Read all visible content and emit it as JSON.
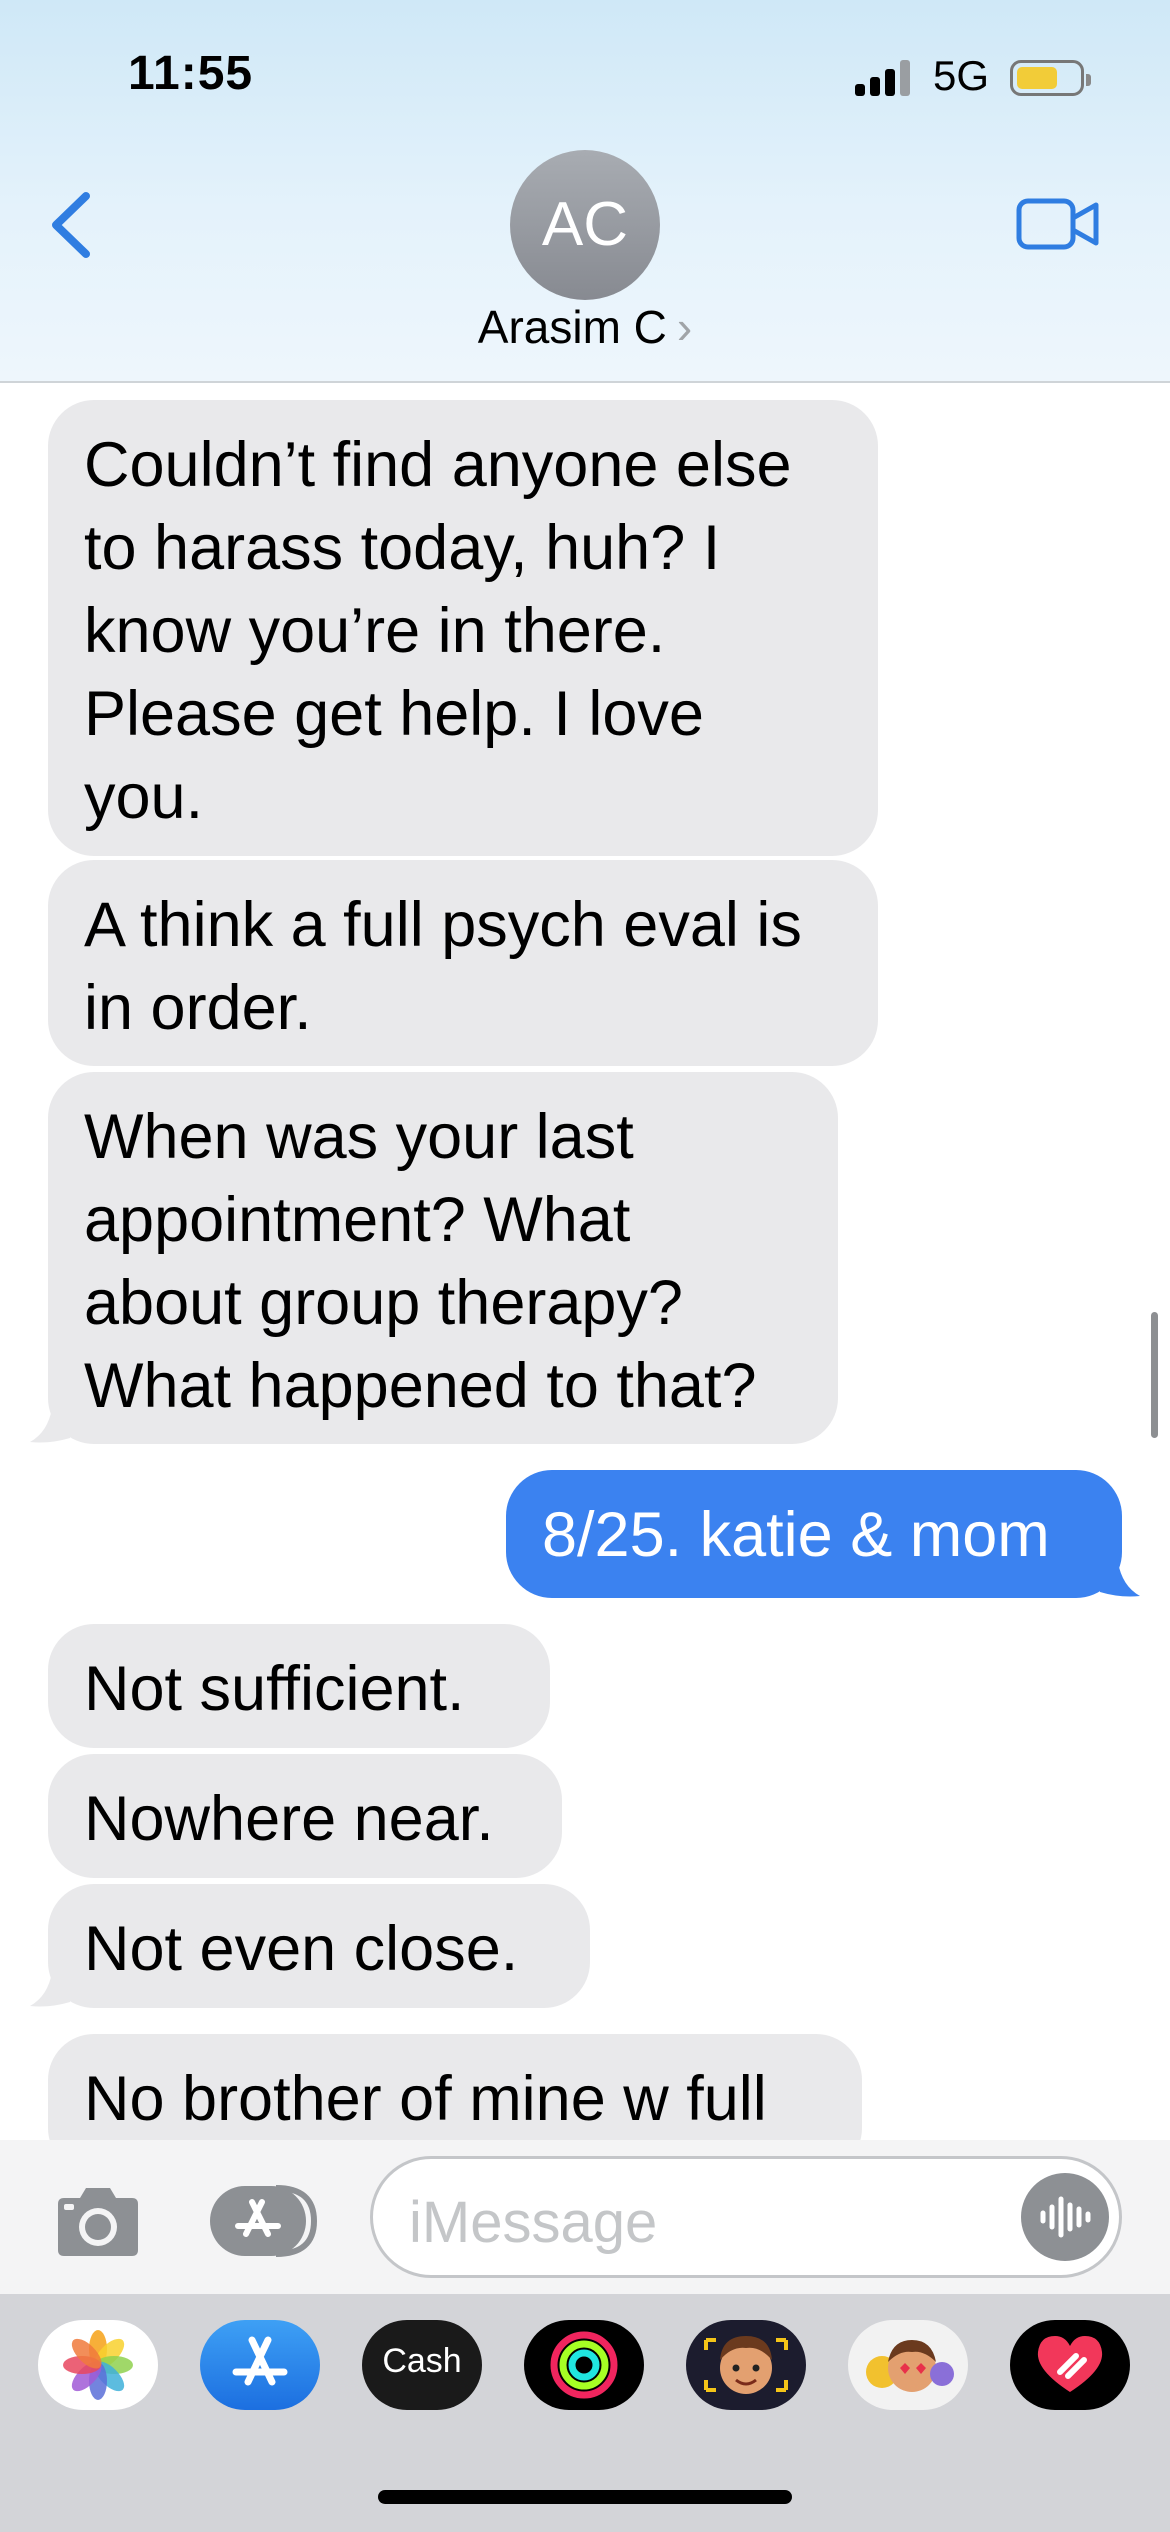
{
  "status_bar": {
    "time": "11:55",
    "network": "5G"
  },
  "header": {
    "avatar_initials": "AC",
    "contact_name": "Arasim C",
    "chevron": "›",
    "back_icon": "chevron-left-icon",
    "video_icon": "video-camera-icon"
  },
  "messages": [
    {
      "direction": "incoming",
      "text": "Couldn’t find anyone else\nto harass today, huh?  I\nknow you’re in there.\nPlease get help.  I love\nyou."
    },
    {
      "direction": "incoming",
      "text": "A think a full psych eval is\nin order."
    },
    {
      "direction": "incoming",
      "text": "When was your last\nappointment?  What\nabout group therapy?\nWhat happened to that?"
    },
    {
      "direction": "outgoing",
      "text": "8/25. katie & mom"
    },
    {
      "direction": "incoming",
      "text": "Not sufficient."
    },
    {
      "direction": "incoming",
      "text": "Nowhere near."
    },
    {
      "direction": "incoming",
      "text": "Not even close."
    },
    {
      "direction": "incoming",
      "text": "No brother of mine w full"
    }
  ],
  "input": {
    "placeholder": "iMessage"
  },
  "app_drawer": [
    {
      "name": "Photos",
      "icon": "photos-icon"
    },
    {
      "name": "App Store",
      "icon": "app-store-icon"
    },
    {
      "name": "Cash",
      "icon": "cash-app-icon",
      "label": "Cash"
    },
    {
      "name": "Activity",
      "icon": "activity-rings-icon"
    },
    {
      "name": "Memoji",
      "icon": "memoji-icon"
    },
    {
      "name": "Memoji Stickers",
      "icon": "memoji-stickers-icon"
    },
    {
      "name": "Digital Touch",
      "icon": "digital-touch-icon"
    }
  ],
  "colors": {
    "incoming_bubble": "#e9e9eb",
    "outgoing_bubble": "#3b82f0",
    "accent": "#2f7de1",
    "battery": "#f2cc38"
  }
}
